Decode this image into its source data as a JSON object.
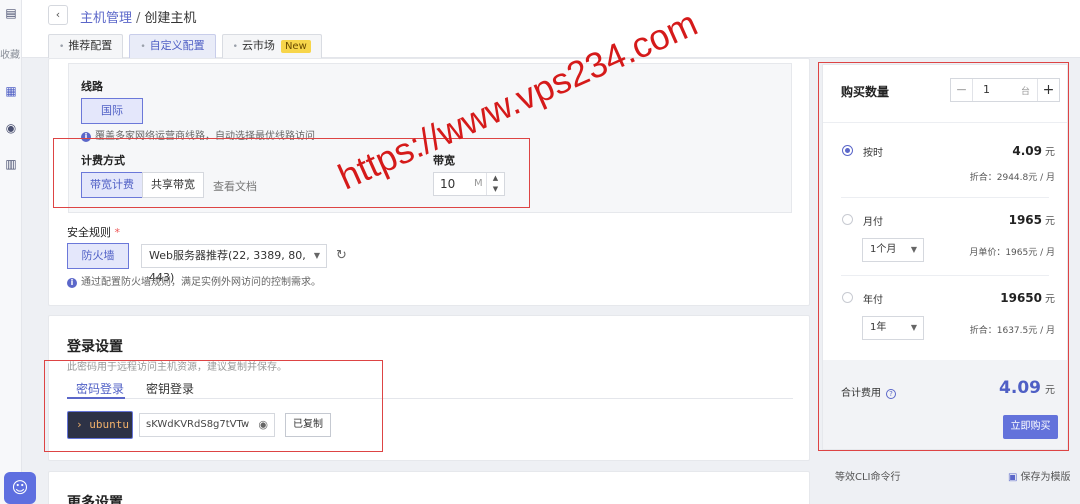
{
  "rail": {
    "fav_label": "收藏"
  },
  "header": {
    "breadcrumb_parent": "主机管理",
    "breadcrumb_sep": "/",
    "breadcrumb_current": "创建主机",
    "tabs": [
      {
        "label": "推荐配置"
      },
      {
        "label": "自定义配置"
      },
      {
        "label": "云市场",
        "badge": "New"
      }
    ]
  },
  "network": {
    "line_label": "线路",
    "line_option": "国际",
    "line_hint": "覆盖多家网络运营商线路，自动选择最优线路访问",
    "billing_label": "计费方式",
    "billing_options": [
      "带宽计费",
      "共享带宽"
    ],
    "doc_link": "查看文档",
    "bandwidth_label": "带宽",
    "bandwidth_value": "10",
    "bandwidth_unit": "M"
  },
  "security": {
    "label": "安全规则",
    "required_mark": "*",
    "firewall": "防火墙",
    "rule_select": "Web服务器推荐(22, 3389, 80, 443)",
    "hint": "通过配置防火墙规则，满足实例外网访问的控制需求。"
  },
  "login": {
    "title": "登录设置",
    "subtitle": "此密码用于远程访问主机资源，建议复制并保存。",
    "tabs": [
      "密码登录",
      "密钥登录"
    ],
    "username": "› ubuntu",
    "password": "sKWdKVRdS8g7tVTw",
    "copy_label": "已复制"
  },
  "more": {
    "title": "更多设置"
  },
  "purchase": {
    "qty_label": "购买数量",
    "qty_value": "1",
    "qty_unit": "台",
    "hourly": {
      "label": "按时",
      "price": "4.09",
      "currency": "元",
      "sub": "折合：2944.8元 / 月"
    },
    "monthly": {
      "label": "月付",
      "price": "1965",
      "currency": "元",
      "period": "1个月",
      "sub": "月单价：1965元 / 月"
    },
    "yearly": {
      "label": "年付",
      "price": "19650",
      "currency": "元",
      "period": "1年",
      "sub": "折合：1637.5元 / 月"
    },
    "total_label": "合计费用",
    "total_value": "4.09",
    "total_currency": "元",
    "buy_label": "立即购买",
    "cli_link": "等效CLI命令行",
    "save_template": "保存为模版"
  },
  "watermark": "https://www.vps234.com",
  "colors": {
    "accent": "#5b67c9",
    "annotation": "#dd4444",
    "watermark": "#d51a1a"
  }
}
